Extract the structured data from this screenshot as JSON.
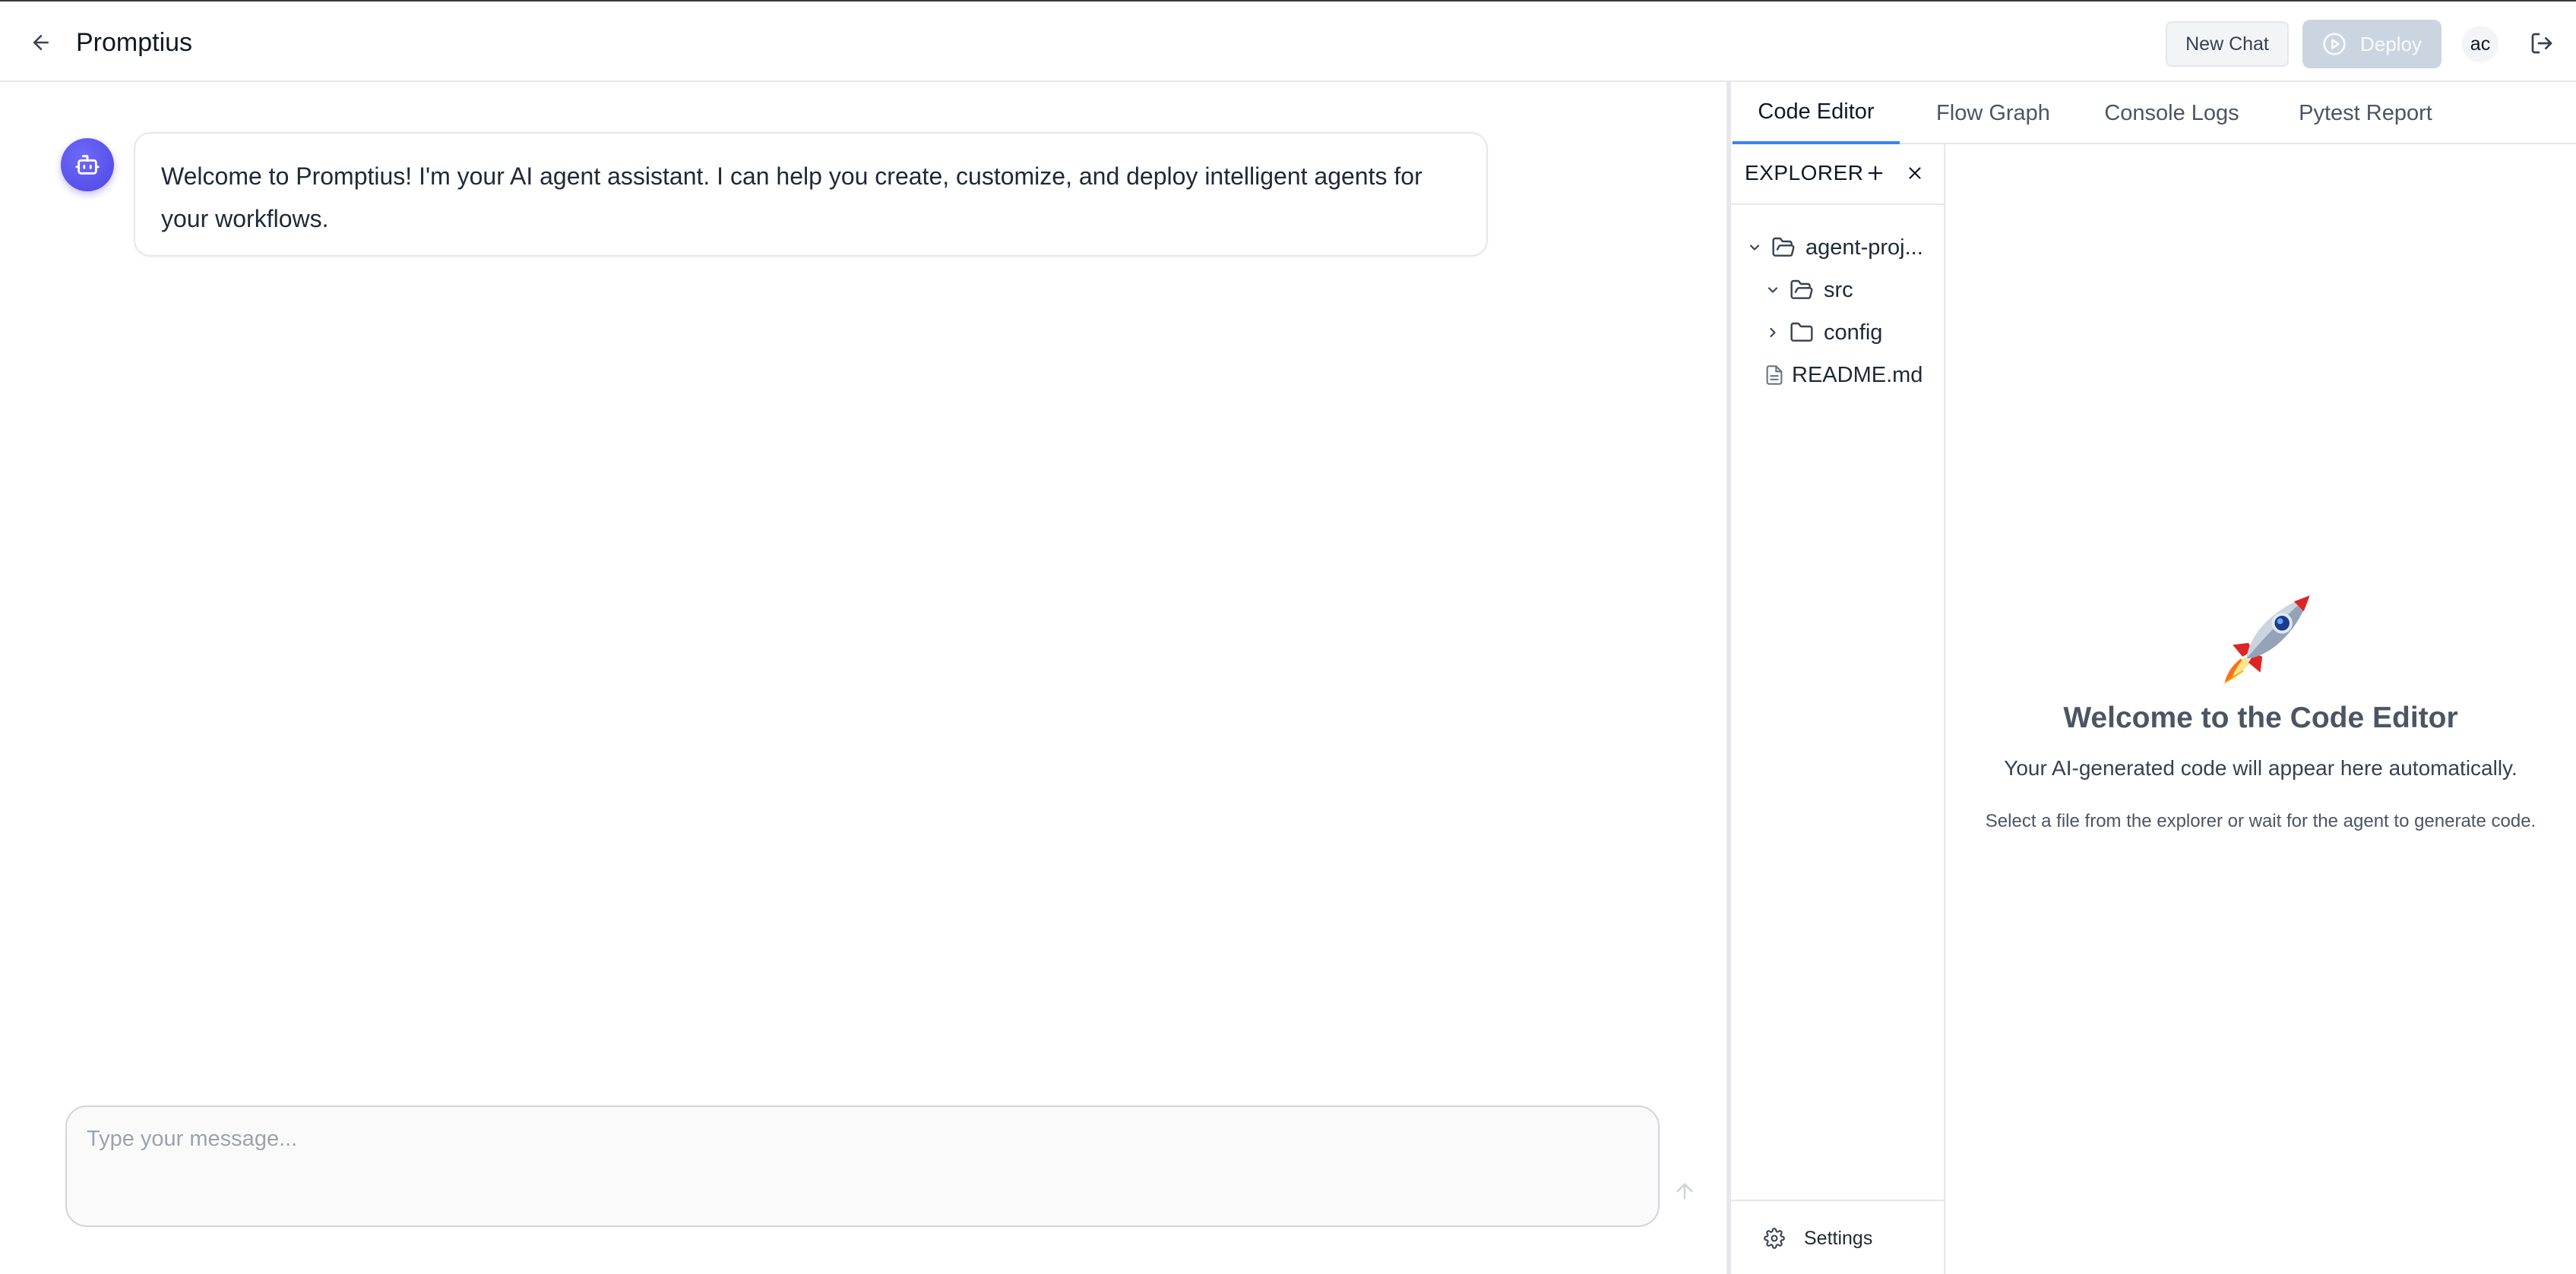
{
  "header": {
    "app_title": "Promptius",
    "new_chat_label": "New Chat",
    "deploy_label": "Deploy",
    "avatar_initials": "ac"
  },
  "chat": {
    "messages": [
      {
        "role": "assistant",
        "text": "Welcome to Promptius! I'm your AI agent assistant. I can help you create, customize, and deploy intelligent agents for your workflows."
      }
    ],
    "composer": {
      "value": "",
      "placeholder": "Type your message..."
    }
  },
  "tabs": [
    {
      "label": "Code Editor",
      "active": true
    },
    {
      "label": "Flow Graph",
      "active": false
    },
    {
      "label": "Console Logs",
      "active": false
    },
    {
      "label": "Pytest Report",
      "active": false
    }
  ],
  "explorer": {
    "title": "EXPLORER",
    "tree": [
      {
        "label": "agent-proj...",
        "type": "folder",
        "expanded": true
      },
      {
        "label": "src",
        "type": "folder",
        "expanded": true
      },
      {
        "label": "config",
        "type": "folder",
        "expanded": false
      },
      {
        "label": "README.md",
        "type": "file"
      }
    ],
    "settings_label": "Settings"
  },
  "editor": {
    "emoji": "🚀",
    "welcome_title": "Welcome to the Code Editor",
    "welcome_subtitle": "Your AI-generated code will appear here automatically.",
    "welcome_hint": "Select a file from the explorer or wait for the agent to generate code."
  },
  "colors": {
    "accent": "#3b82f6",
    "bot_avatar": "#4f46e5",
    "deploy_disabled": "#cbd5e1"
  }
}
